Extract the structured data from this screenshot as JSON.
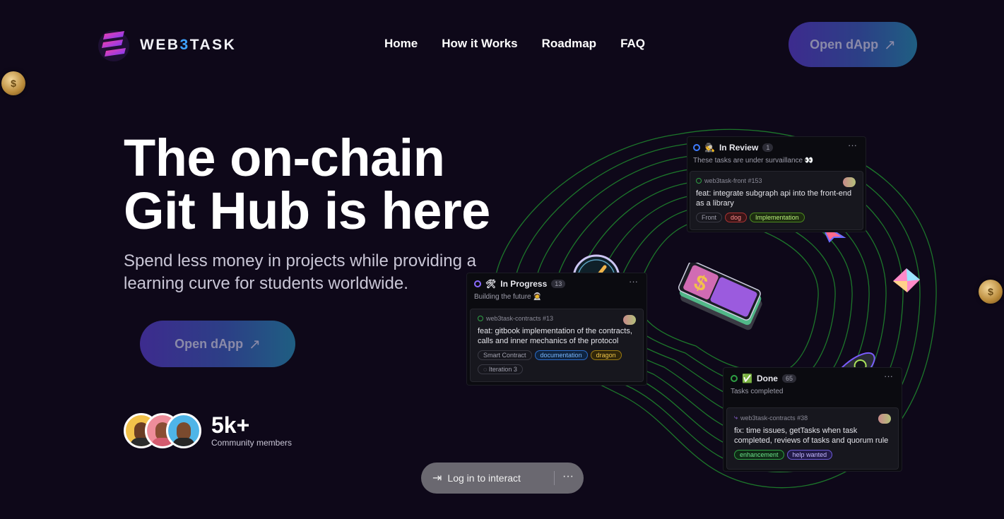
{
  "logo": {
    "text_pre": "WEB",
    "text_hl": "3",
    "text_post": "TASK"
  },
  "nav": {
    "items": [
      "Home",
      "How it Works",
      "Roadmap",
      "FAQ"
    ],
    "cta_label": "Open dApp",
    "cta_icon": "arrow-up-right-icon"
  },
  "hero": {
    "title_line1": "The on-chain",
    "title_line2": "Git Hub is here",
    "subtitle": "Spend less money in projects while providing a learning curve for students worldwide.",
    "cta_label": "Open dApp"
  },
  "community": {
    "count": "5k+",
    "label": "Community members"
  },
  "login_pill": {
    "label": "Log in to interact",
    "more": "···"
  },
  "coin_symbol": "$",
  "board": {
    "review": {
      "title": "In Review",
      "emoji": "🕵",
      "count": "1",
      "subtitle": "These tasks are under survaillance 👀",
      "task": {
        "ref": "web3task-front #153",
        "title": "feat: integrate subgraph api into the front-end as a library",
        "tags": [
          "Front",
          "dog",
          "Implementation"
        ]
      }
    },
    "progress": {
      "title": "In Progress",
      "emoji": "🛠",
      "count": "13",
      "subtitle": "Building the future 🧑‍🚀",
      "task": {
        "ref": "web3task-contracts #13",
        "title": "feat: gitbook implementation of the contracts, calls and inner mechanics of the protocol",
        "tags": [
          "Smart Contract",
          "documentation",
          "dragon"
        ],
        "iteration": "Iteration 3"
      }
    },
    "done": {
      "title": "Done",
      "emoji": "✅",
      "count": "65",
      "subtitle": "Tasks completed",
      "task": {
        "ref": "web3task-contracts #38",
        "title": "fix: time issues, getTasks when task completed, reviews of tasks and quorum rule",
        "tags": [
          "enhancement",
          "help wanted"
        ]
      }
    }
  },
  "colors": {
    "background": "#0e0819",
    "accent_blue": "#3fa3ff",
    "button_start": "#3d2b8e",
    "button_end": "#1f5e82",
    "contour_green": "#1f8a2e"
  }
}
